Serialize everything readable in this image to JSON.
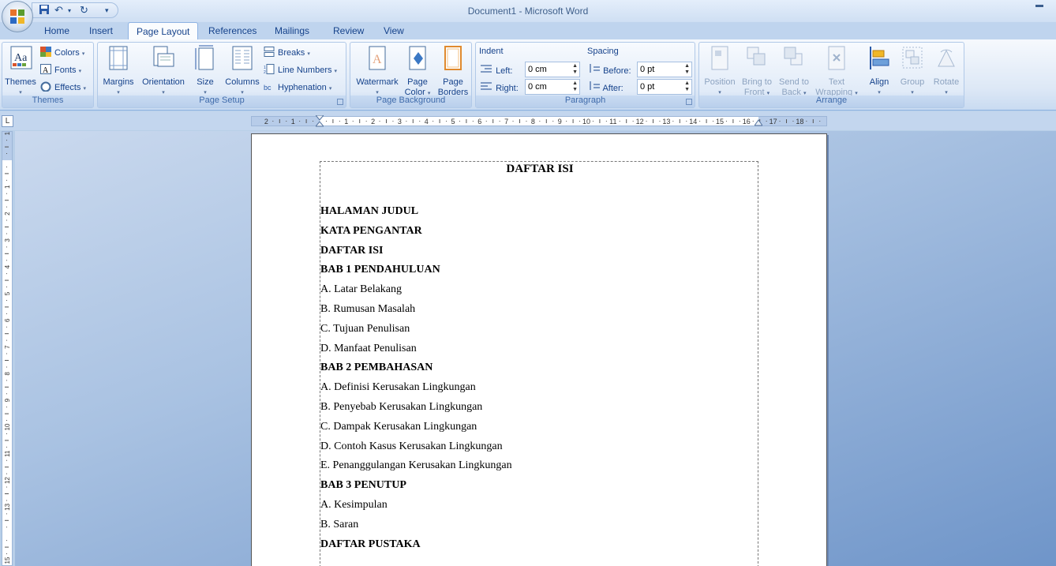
{
  "window": {
    "title": "Document1 - Microsoft Word"
  },
  "tabs": [
    "Home",
    "Insert",
    "Page Layout",
    "References",
    "Mailings",
    "Review",
    "View"
  ],
  "active_tab": "Page Layout",
  "ribbon": {
    "themes": {
      "themes_label": "Themes",
      "colors_label": "Colors",
      "fonts_label": "Fonts",
      "effects_label": "Effects",
      "group_label": "Themes"
    },
    "page_setup": {
      "margins_label": "Margins",
      "orientation_label": "Orientation",
      "size_label": "Size",
      "columns_label": "Columns",
      "breaks_label": "Breaks",
      "line_numbers_label": "Line Numbers",
      "hyphenation_label": "Hyphenation",
      "group_label": "Page Setup"
    },
    "page_background": {
      "watermark_label": "Watermark",
      "page_color_line1": "Page",
      "page_color_line2": "Color",
      "page_borders_line1": "Page",
      "page_borders_line2": "Borders",
      "group_label": "Page Background"
    },
    "paragraph": {
      "indent_label": "Indent",
      "left_label": "Left:",
      "left_value": "0 cm",
      "right_label": "Right:",
      "right_value": "0 cm",
      "spacing_label": "Spacing",
      "before_label": "Before:",
      "before_value": "0 pt",
      "after_label": "After:",
      "after_value": "0 pt",
      "group_label": "Paragraph"
    },
    "arrange": {
      "position_label": "Position",
      "bring_line1": "Bring to",
      "bring_line2": "Front",
      "send_line1": "Send to",
      "send_line2": "Back",
      "text_line1": "Text",
      "text_line2": "Wrapping",
      "align_label": "Align",
      "group_label_btn": "Group",
      "rotate_label": "Rotate",
      "group_label": "Arrange"
    }
  },
  "ruler": {
    "labels": [
      "2",
      "1",
      "1",
      "2",
      "3",
      "4",
      "5",
      "6",
      "7",
      "8",
      "9",
      "10",
      "11",
      "12",
      "13",
      "14",
      "15",
      "16",
      "17",
      "18"
    ],
    "vlabels": [
      "1",
      "1",
      "2",
      "3",
      "4",
      "5",
      "6",
      "7",
      "8",
      "9",
      "10",
      "11",
      "12",
      "13",
      "15"
    ]
  },
  "document": {
    "title": "DAFTAR ISI",
    "lines": [
      {
        "text": "HALAMAN JUDUL",
        "bold": true
      },
      {
        "text": "KATA PENGANTAR",
        "bold": true
      },
      {
        "text": "DAFTAR ISI",
        "bold": true
      },
      {
        "text": "BAB 1 PENDAHULUAN",
        "bold": true
      },
      {
        "text": "A. Latar Belakang",
        "bold": false
      },
      {
        "text": "B. Rumusan Masalah",
        "bold": false
      },
      {
        "text": "C. Tujuan Penulisan",
        "bold": false
      },
      {
        "text": "D. Manfaat Penulisan",
        "bold": false
      },
      {
        "text": "BAB 2 PEMBAHASAN",
        "bold": true
      },
      {
        "text": "A. Definisi Kerusakan Lingkungan",
        "bold": false
      },
      {
        "text": "B. Penyebab Kerusakan Lingkungan",
        "bold": false
      },
      {
        "text": "C. Dampak Kerusakan Lingkungan",
        "bold": false
      },
      {
        "text": "D. Contoh Kasus Kerusakan Lingkungan",
        "bold": false
      },
      {
        "text": "E. Penanggulangan Kerusakan Lingkungan",
        "bold": false
      },
      {
        "text": "BAB 3 PENUTUP",
        "bold": true
      },
      {
        "text": "A. Kesimpulan",
        "bold": false
      },
      {
        "text": "B. Saran",
        "bold": false
      },
      {
        "text": "DAFTAR PUSTAKA",
        "bold": true
      }
    ]
  }
}
